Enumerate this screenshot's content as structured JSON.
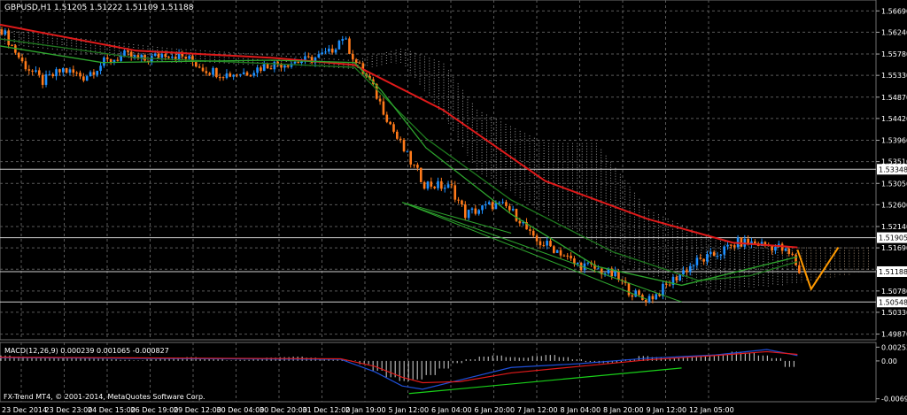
{
  "chart_data": [
    {
      "type": "candlestick",
      "symbol_header": "GBPUSD,H1  1.51205 1.51222 1.51109 1.51188",
      "ylim": [
        1.4975,
        1.5692
      ],
      "y_ticks": [
        "1.56690",
        "1.56240",
        "1.55780",
        "1.55330",
        "1.54870",
        "1.54420",
        "1.53960",
        "1.53510",
        "1.53050",
        "1.52600",
        "1.52140",
        "1.51690",
        "1.51240",
        "1.50780",
        "1.50330",
        "1.49870"
      ],
      "horizontal_levels": [
        {
          "label": "1.53348",
          "value": 1.53348
        },
        {
          "label": "1.51905",
          "value": 1.51905
        },
        {
          "label": "1.51188",
          "value": 1.51188
        },
        {
          "label": "1.50548",
          "value": 1.50548
        }
      ],
      "x_ticks": [
        "23 Dec 2014",
        "23 Dec 23:00",
        "24 Dec 15:00",
        "26 Dec 19:00",
        "29 Dec 12:00",
        "30 Dec 04:00",
        "30 Dec 20:00",
        "31 Dec 12:00",
        "2 Jan 19:00",
        "5 Jan 12:00",
        "6 Jan 04:00",
        "6 Jan 20:00",
        "7 Jan 12:00",
        "8 Jan 04:00",
        "8 Jan 20:00",
        "9 Jan 12:00",
        "12 Jan 05:00"
      ],
      "price_path": [
        [
          0,
          1.563
        ],
        [
          6,
          1.556
        ],
        [
          12,
          1.552
        ],
        [
          18,
          1.5545
        ],
        [
          24,
          1.553
        ],
        [
          30,
          1.556
        ],
        [
          36,
          1.5575
        ],
        [
          42,
          1.5565
        ],
        [
          48,
          1.558
        ],
        [
          54,
          1.557
        ],
        [
          60,
          1.5545
        ],
        [
          66,
          1.5535
        ],
        [
          72,
          1.554
        ],
        [
          78,
          1.5555
        ],
        [
          84,
          1.556
        ],
        [
          90,
          1.5565
        ],
        [
          96,
          1.558
        ],
        [
          100,
          1.5615
        ],
        [
          104,
          1.556
        ],
        [
          108,
          1.552
        ],
        [
          112,
          1.546
        ],
        [
          116,
          1.54
        ],
        [
          120,
          1.535
        ],
        [
          124,
          1.5305
        ],
        [
          128,
          1.53
        ],
        [
          132,
          1.5295
        ],
        [
          136,
          1.524
        ],
        [
          140,
          1.525
        ],
        [
          144,
          1.526
        ],
        [
          148,
          1.5255
        ],
        [
          152,
          1.523
        ],
        [
          156,
          1.5185
        ],
        [
          160,
          1.5175
        ],
        [
          164,
          1.516
        ],
        [
          168,
          1.5135
        ],
        [
          172,
          1.513
        ],
        [
          176,
          1.512
        ],
        [
          180,
          1.511
        ],
        [
          184,
          1.508
        ],
        [
          188,
          1.506
        ],
        [
          192,
          1.507
        ],
        [
          196,
          1.5095
        ],
        [
          200,
          1.512
        ],
        [
          204,
          1.514
        ],
        [
          208,
          1.515
        ],
        [
          212,
          1.5165
        ],
        [
          216,
          1.518
        ],
        [
          220,
          1.518
        ],
        [
          224,
          1.5175
        ],
        [
          228,
          1.517
        ],
        [
          232,
          1.515
        ],
        [
          234,
          1.5119
        ]
      ],
      "moving_averages": [
        {
          "name": "red-ma",
          "color": "#e01a1a",
          "points": [
            [
              0,
              1.564
            ],
            [
              40,
              1.5585
            ],
            [
              80,
              1.557
            ],
            [
              104,
              1.5555
            ],
            [
              130,
              1.546
            ],
            [
              160,
              1.531
            ],
            [
              190,
              1.523
            ],
            [
              215,
              1.518
            ],
            [
              234,
              1.517
            ]
          ]
        },
        {
          "name": "dark-green-ma",
          "color": "#1f7a1f",
          "points": [
            [
              0,
              1.561
            ],
            [
              40,
              1.557
            ],
            [
              104,
              1.555
            ],
            [
              125,
              1.54
            ],
            [
              150,
              1.527
            ],
            [
              180,
              1.516
            ],
            [
              205,
              1.51
            ],
            [
              220,
              1.511
            ],
            [
              234,
              1.514
            ]
          ]
        },
        {
          "name": "green-ma",
          "color": "#2ea62e",
          "points": [
            [
              0,
              1.5595
            ],
            [
              30,
              1.556
            ],
            [
              80,
              1.5565
            ],
            [
              104,
              1.556
            ],
            [
              112,
              1.55
            ],
            [
              125,
              1.538
            ],
            [
              150,
              1.524
            ],
            [
              175,
              1.513
            ],
            [
              200,
              1.509
            ],
            [
              234,
              1.515
            ]
          ]
        }
      ],
      "ichimoku_cloud": {
        "color": "#e0e0e0",
        "future_color": "#e8c8a8",
        "upper": [
          [
            0,
            1.563
          ],
          [
            50,
            1.559
          ],
          [
            104,
            1.5565
          ],
          [
            118,
            1.559
          ],
          [
            130,
            1.556
          ],
          [
            140,
            1.546
          ],
          [
            160,
            1.539
          ],
          [
            175,
            1.539
          ],
          [
            190,
            1.525
          ],
          [
            210,
            1.5185
          ],
          [
            230,
            1.517
          ],
          [
            256,
            1.517
          ]
        ],
        "lower": [
          [
            0,
            1.56
          ],
          [
            50,
            1.556
          ],
          [
            104,
            1.5545
          ],
          [
            118,
            1.556
          ],
          [
            130,
            1.545
          ],
          [
            140,
            1.533
          ],
          [
            160,
            1.524
          ],
          [
            175,
            1.517
          ],
          [
            190,
            1.511
          ],
          [
            210,
            1.508
          ],
          [
            230,
            1.509
          ],
          [
            256,
            1.512
          ]
        ]
      },
      "trend_lines": [
        {
          "color": "#2ea62e",
          "from": [
            118,
            1.5265
          ],
          "to": [
            190,
            1.506
          ]
        },
        {
          "color": "#2ea62e",
          "from": [
            118,
            1.5265
          ],
          "to": [
            200,
            1.5055
          ]
        },
        {
          "color": "#2ea62e",
          "from": [
            118,
            1.5265
          ],
          "to": [
            150,
            1.52
          ]
        }
      ],
      "projection": {
        "color": "#ff9900",
        "points": [
          [
            234,
            1.5165
          ],
          [
            238,
            1.5082
          ],
          [
            246,
            1.517
          ]
        ]
      }
    },
    {
      "type": "bar",
      "label": "MACD(12,26,9) 0.000239 0.001065 -0.000827",
      "ylim": [
        -0.0075,
        0.0034
      ],
      "y_ticks": [
        "0.002535",
        "0.00",
        "-0.006958"
      ],
      "histogram": [
        0.001,
        0.0008,
        0.0006,
        0.0005,
        0.0006,
        0.0007,
        0.0005,
        0.0004,
        0.0003,
        0.0002,
        0.0001,
        0.0003,
        0.0005,
        0.0006,
        0.0007,
        0.0005,
        0.0003,
        0.0001,
        0.0002,
        0.0004,
        0.0006,
        0.0007,
        0.0008,
        0.0006,
        0.0004,
        0.0002,
        0.0001,
        -0.0006,
        -0.0018,
        -0.003,
        -0.0037,
        -0.0034,
        -0.0026,
        -0.0014,
        -0.0004,
        0.0003,
        0.0008,
        0.001,
        0.0007,
        0.0006,
        0.0009,
        0.0011,
        0.0007,
        0.0003,
        -0.0002,
        -0.0004,
        -0.0003,
        0.0003,
        0.0009,
        0.0007,
        0.0005,
        0.0006,
        0.0008,
        0.0009,
        0.0012,
        0.0017,
        0.0015,
        0.001,
        0.0005,
        -0.0011
      ],
      "macd_line": {
        "color": "#1e4fd8",
        "points": [
          [
            0,
            0.0006
          ],
          [
            30,
            0.0005
          ],
          [
            60,
            0.0004
          ],
          [
            100,
            0.0003
          ],
          [
            110,
            -0.002
          ],
          [
            118,
            -0.0046
          ],
          [
            124,
            -0.0052
          ],
          [
            135,
            -0.0035
          ],
          [
            150,
            -0.0012
          ],
          [
            170,
            -0.0005
          ],
          [
            190,
            0.0005
          ],
          [
            210,
            0.0011
          ],
          [
            225,
            0.0021
          ],
          [
            234,
            0.001
          ]
        ]
      },
      "signal_line": {
        "color": "#e01a1a",
        "points": [
          [
            0,
            0.0007
          ],
          [
            30,
            0.0006
          ],
          [
            60,
            0.0005
          ],
          [
            100,
            0.0004
          ],
          [
            110,
            -0.001
          ],
          [
            118,
            -0.003
          ],
          [
            124,
            -0.004
          ],
          [
            135,
            -0.0038
          ],
          [
            150,
            -0.0022
          ],
          [
            170,
            -0.001
          ],
          [
            190,
            0.0002
          ],
          [
            210,
            0.001
          ],
          [
            225,
            0.0017
          ],
          [
            234,
            0.0012
          ]
        ]
      },
      "signal_trend": {
        "color": "#19d019",
        "from": [
          120,
          -0.006
        ],
        "to": [
          200,
          -0.0013
        ]
      }
    }
  ],
  "footer_text": "FX-Trend MT4, © 2001-2014, MetaQuotes Software Corp.",
  "colors": {
    "bull": "#1e90ff",
    "bear": "#ff7a1a",
    "grid": "#5a5a5a",
    "axis_text": "#ffffff",
    "bg": "#000000"
  }
}
